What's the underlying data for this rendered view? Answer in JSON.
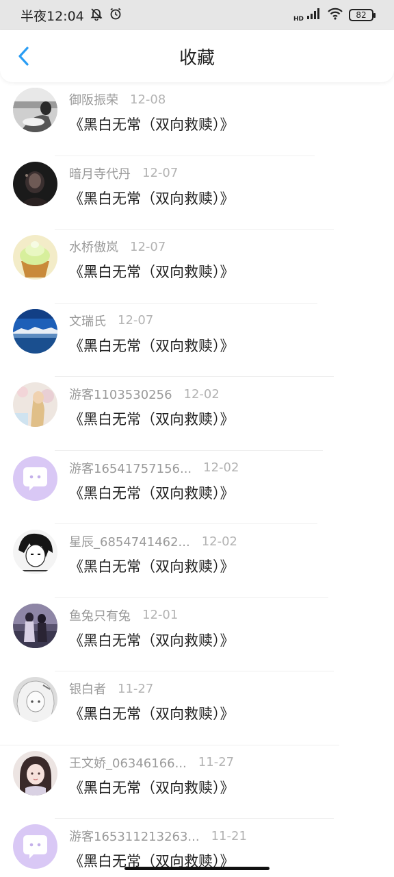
{
  "status_bar": {
    "time": "半夜12:04",
    "battery": "82",
    "hd": "HD"
  },
  "nav": {
    "title": "收藏"
  },
  "items": [
    {
      "user": "御阪振荣",
      "date": "12-08",
      "title": "《黑白无常（双向救赎）》",
      "avatar": "avatar-photo-1"
    },
    {
      "user": "暗月寺代丹",
      "date": "12-07",
      "title": "《黑白无常（双向救赎）》",
      "avatar": "avatar-photo-2"
    },
    {
      "user": "水桥傲岚",
      "date": "12-07",
      "title": "《黑白无常（双向救赎）》",
      "avatar": "avatar-cupcake"
    },
    {
      "user": "文瑞氏",
      "date": "12-07",
      "title": "《黑白无常（双向救赎）》",
      "avatar": "avatar-landscape"
    },
    {
      "user": "游客1103530256",
      "date": "12-02",
      "title": "《黑白无常（双向救赎）》",
      "avatar": "avatar-photo-5"
    },
    {
      "user": "游客16541757156...",
      "date": "12-02",
      "title": "《黑白无常（双向救赎）》",
      "avatar": "avatar-default"
    },
    {
      "user": "星辰_6854741462...",
      "date": "12-02",
      "title": "《黑白无常（双向救赎）》",
      "avatar": "avatar-anime-1"
    },
    {
      "user": "鱼兔只有兔",
      "date": "12-01",
      "title": "《黑白无常（双向救赎）》",
      "avatar": "avatar-photo-8"
    },
    {
      "user": "银白者",
      "date": "11-27",
      "title": "《黑白无常（双向救赎）》",
      "avatar": "avatar-anime-2"
    },
    {
      "user": "王文娇_06346166...",
      "date": "11-27",
      "title": "《黑白无常（双向救赎）》",
      "avatar": "avatar-anime-3"
    },
    {
      "user": "游客165311213263...",
      "date": "11-21",
      "title": "《黑白无常（双向救赎）》",
      "avatar": "avatar-default"
    }
  ],
  "colors": {
    "accent": "#2a9df4",
    "default_avatar": "#d9c8f5"
  }
}
